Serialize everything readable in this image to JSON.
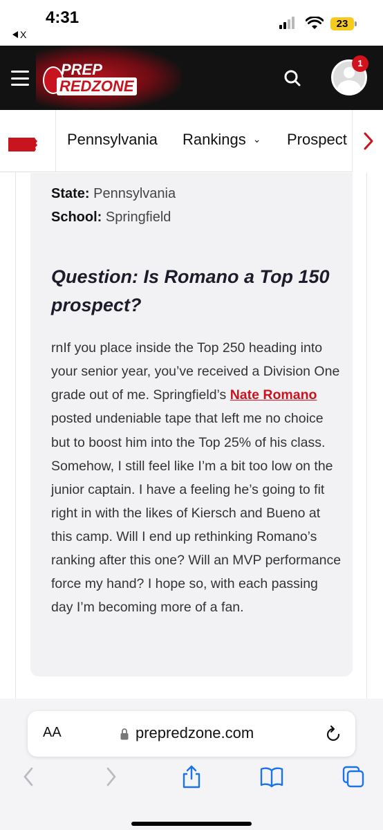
{
  "status_bar": {
    "time": "4:31",
    "back_label": "X",
    "battery": "23"
  },
  "header": {
    "logo_line1": "PREP",
    "logo_line2": "REDZONE",
    "notification_count": "1",
    "brand_red": "#c8141e",
    "header_bg": "#121212"
  },
  "subnav": {
    "items": [
      {
        "label": "Pennsylvania"
      },
      {
        "label": "Rankings"
      },
      {
        "label": "Prospect"
      }
    ]
  },
  "article": {
    "state_label": "State:",
    "state_value": "Pennsylvania",
    "school_label": "School:",
    "school_value": "Springfield",
    "question": "Question: Is Romano a Top 150 prospect?",
    "body_before_link": "rnIf you place inside the Top 250 heading into your senior year, you’ve received a Division One grade out of me. Springfield’s ",
    "link_text": "Nate Romano",
    "body_after_link": " posted undeniable tape that left me no choice but to boost him into the Top 25% of his class. Somehow, I still feel like I’m a bit too low on the junior captain. I have a feeling he’s going to fit right in with the likes of Kiersch and Bueno at this camp. Will I end up rethinking Romano’s ranking after this one? Will an MVP performance force my hand? I hope so, with each passing day I’m becoming more of a fan."
  },
  "browser": {
    "aa_label": "AA",
    "url": "prepredzone.com",
    "icons": [
      "back-icon",
      "forward-icon",
      "share-icon",
      "bookmarks-icon",
      "tabs-icon"
    ]
  }
}
